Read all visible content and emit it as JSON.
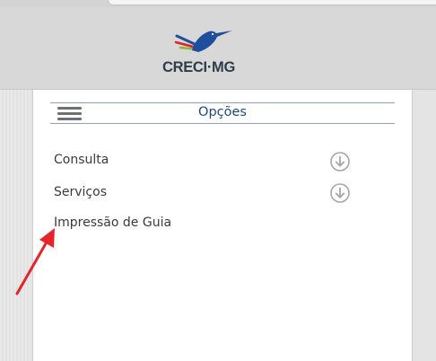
{
  "header": {
    "logo_text": "CRECI·MG"
  },
  "panel": {
    "title": "Opções",
    "items": [
      {
        "label": "Consulta",
        "expandable": true,
        "icon": "circle-arrow-down-icon"
      },
      {
        "label": "Serviços",
        "expandable": true,
        "icon": "circle-arrow-down-icon"
      },
      {
        "label": "Impressão de Guia",
        "expandable": false
      }
    ]
  },
  "colors": {
    "title_text": "#1e4779",
    "divider": "#8da0b6",
    "annotation_arrow": "#e3242b",
    "logo_blue": "#1f4e9c",
    "logo_green": "#8ab833",
    "logo_red": "#d8232a"
  }
}
